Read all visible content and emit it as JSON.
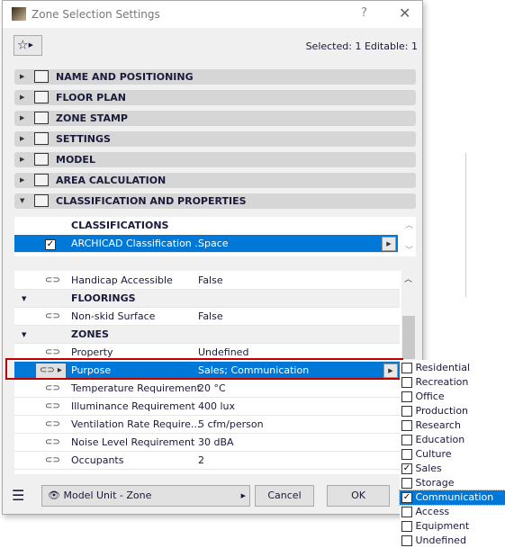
{
  "window": {
    "title": "Zone Selection Settings",
    "help": "?",
    "close": "✕"
  },
  "toolbar": {
    "favorites_icon": "star-icon",
    "selection_info": "Selected: 1 Editable: 1"
  },
  "sections": [
    {
      "label": "NAME AND POSITIONING",
      "expanded": false
    },
    {
      "label": "FLOOR PLAN",
      "expanded": false
    },
    {
      "label": "ZONE STAMP",
      "expanded": false
    },
    {
      "label": "SETTINGS",
      "expanded": false
    },
    {
      "label": "MODEL",
      "expanded": false
    },
    {
      "label": "AREA CALCULATION",
      "expanded": false
    },
    {
      "label": "CLASSIFICATION AND PROPERTIES",
      "expanded": true
    }
  ],
  "classifications": {
    "header": "CLASSIFICATIONS",
    "row": {
      "name": "ARCHICAD Classification ...",
      "value": "Space",
      "checked": true
    }
  },
  "properties": [
    {
      "type": "prop",
      "name": "Handicap Accessible",
      "value": "False"
    },
    {
      "type": "group",
      "name": "FLOORINGS"
    },
    {
      "type": "prop",
      "name": "Non-skid Surface",
      "value": "False"
    },
    {
      "type": "group",
      "name": "ZONES"
    },
    {
      "type": "prop",
      "name": "Property",
      "value": "Undefined"
    },
    {
      "type": "prop",
      "name": "Purpose",
      "value": "Sales; Communication",
      "selected": true
    },
    {
      "type": "prop",
      "name": "Temperature Requirement",
      "value": "20 °C"
    },
    {
      "type": "prop",
      "name": "Illuminance Requirement",
      "value": "400 lux"
    },
    {
      "type": "prop",
      "name": "Ventilation Rate Require...",
      "value": "5 cfm/person"
    },
    {
      "type": "prop",
      "name": "Noise Level Requirement",
      "value": "30 dBA"
    },
    {
      "type": "prop",
      "name": "Occupants",
      "value": "2"
    }
  ],
  "footer": {
    "view_dropdown": "Model Unit - Zone",
    "cancel": "Cancel",
    "ok": "OK"
  },
  "purpose_options": [
    {
      "label": "Residential",
      "checked": false
    },
    {
      "label": "Recreation",
      "checked": false
    },
    {
      "label": "Office",
      "checked": false
    },
    {
      "label": "Production",
      "checked": false
    },
    {
      "label": "Research",
      "checked": false
    },
    {
      "label": "Education",
      "checked": false
    },
    {
      "label": "Culture",
      "checked": false
    },
    {
      "label": "Sales",
      "checked": true
    },
    {
      "label": "Storage",
      "checked": false
    },
    {
      "label": "Communication",
      "checked": true,
      "highlighted": true
    },
    {
      "label": "Access",
      "checked": false
    },
    {
      "label": "Equipment",
      "checked": false
    },
    {
      "label": "Undefined",
      "checked": false
    }
  ],
  "colors": {
    "selection": "#0078d7",
    "highlight_box": "#c00000"
  }
}
